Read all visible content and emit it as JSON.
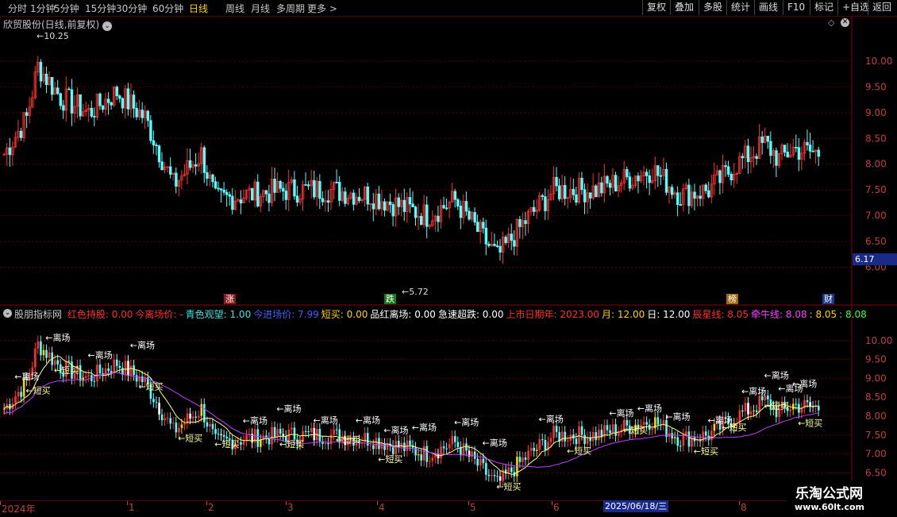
{
  "toolbar": {
    "periods": [
      "分时",
      "1分钟",
      "5分钟",
      "15分钟",
      "30分钟",
      "60分钟",
      "日线",
      "周线",
      "月线",
      "多周期",
      "更多 >"
    ],
    "active_period": "日线",
    "buttons": [
      "复权",
      "叠加",
      "多股",
      "统计",
      "画线",
      "F10",
      "标记",
      "+自选",
      "返回"
    ]
  },
  "main_panel": {
    "title": "欣贸股份(日线,前复权)",
    "high_label": "10.25",
    "low_label": "5.72",
    "current_price": "6.17",
    "y_ticks": [
      "10.00",
      "9.50",
      "9.00",
      "8.50",
      "8.00",
      "7.50",
      "7.00",
      "6.50",
      "6.00"
    ],
    "badges": {
      "zhang": "涨",
      "die": "跌",
      "bang": "榜",
      "cai": "财"
    }
  },
  "indicator_panel": {
    "title": "股朋指标网",
    "fields": [
      {
        "label": "红色持股:",
        "value": "0.00",
        "color": "#ff3030"
      },
      {
        "label": "今离场价:",
        "value": "-",
        "color": "#ff3030"
      },
      {
        "label": "青色观望:",
        "value": "1.00",
        "color": "#40e0e0"
      },
      {
        "label": "今进场价:",
        "value": "7.99",
        "color": "#4060ff"
      },
      {
        "label": "短买:",
        "value": "0.00",
        "color": "#ffd200"
      },
      {
        "label": "品红离场:",
        "value": "0.00",
        "color": "#ffffff"
      },
      {
        "label": "急速超跌:",
        "value": "0.00",
        "color": "#ffffff"
      },
      {
        "label": "上市日期年:",
        "value": "2023.00",
        "color": "#ff3030"
      },
      {
        "label": "月:",
        "value": "12.00",
        "color": "#ffd200"
      },
      {
        "label": "日:",
        "value": "12.00",
        "color": "#ffffff"
      },
      {
        "label": "辰星线:",
        "value": "8.05",
        "color": "#ff3030"
      },
      {
        "label": "牵牛线:",
        "value": "8.08",
        "color": "#ff40ff"
      },
      {
        "label": ":",
        "value": "8.05",
        "color": "#ffd200"
      },
      {
        "label": ":",
        "value": "8.08",
        "color": "#40ff40"
      }
    ],
    "y_ticks": [
      "10.00",
      "9.50",
      "9.00",
      "8.50",
      "8.00",
      "7.50",
      "7.00",
      "6.50"
    ],
    "exit_label": "离场",
    "buy_label": "短买"
  },
  "x_axis": {
    "labels": [
      "2024年",
      "1",
      "2",
      "3",
      "4",
      "5",
      "6",
      "7",
      "8"
    ],
    "cursor_date": "2025/06/18/三"
  },
  "watermark": {
    "line1": "乐淘公式网",
    "line2": "www.60lt.com"
  },
  "colors": {
    "up": "#ff3030",
    "down": "#54ffff",
    "grid": "#5a0000",
    "axis": "#c04040"
  }
}
